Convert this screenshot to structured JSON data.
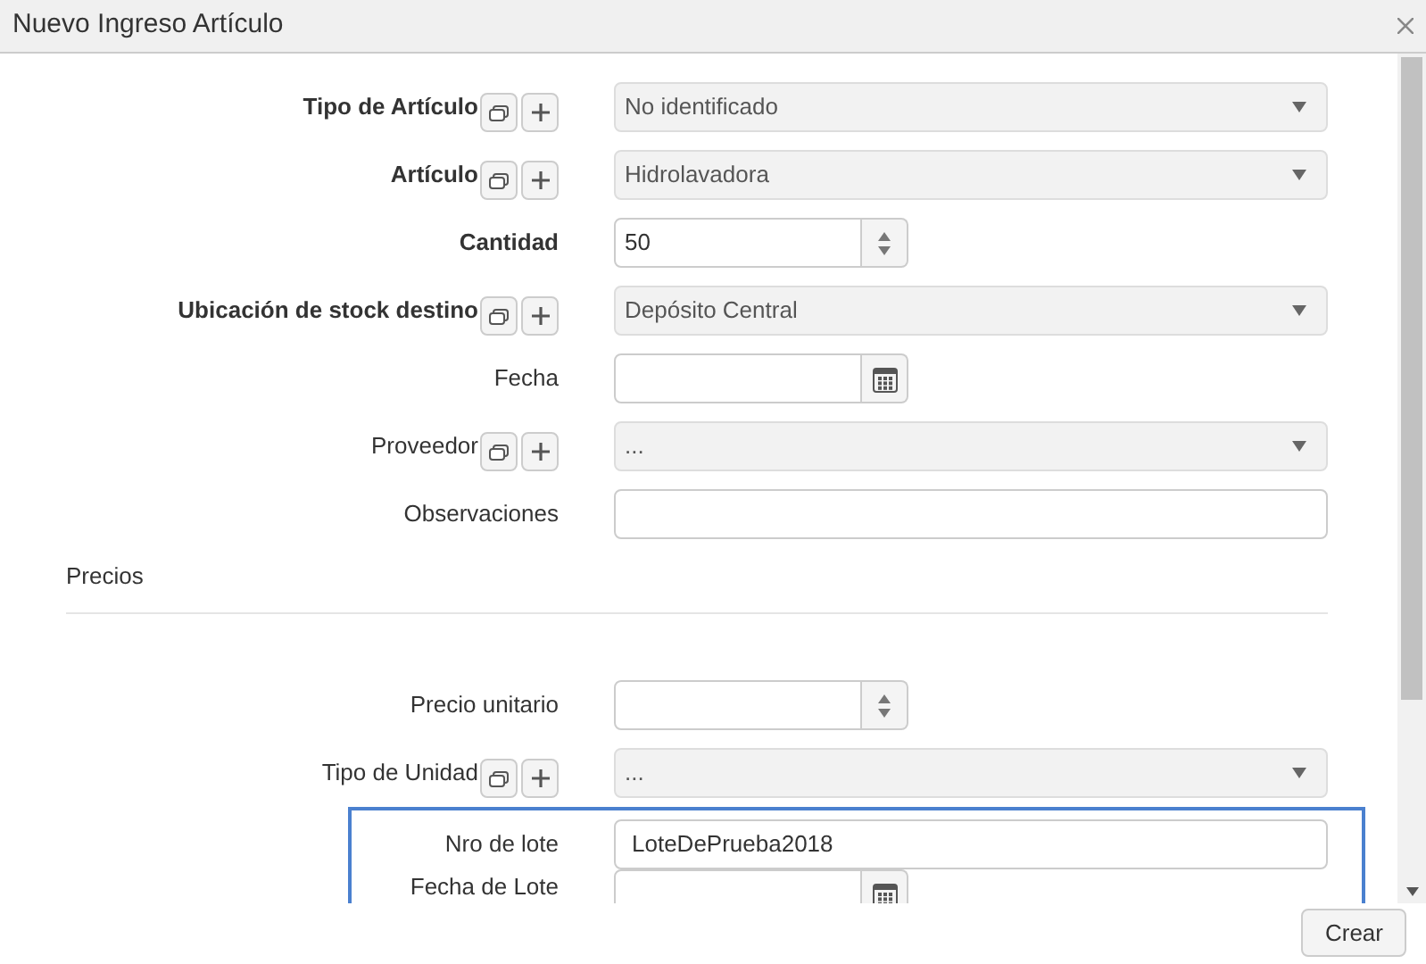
{
  "window": {
    "title": "Nuevo Ingreso Artículo"
  },
  "fields": [
    {
      "label": "Tipo de Artículo",
      "bold": true,
      "kind": "select",
      "lookup_buttons": true,
      "value": "No identificado"
    },
    {
      "label": "Artículo",
      "bold": true,
      "kind": "select",
      "lookup_buttons": true,
      "value": "Hidrolavadora"
    },
    {
      "label": "Cantidad",
      "bold": true,
      "kind": "number",
      "lookup_buttons": false,
      "value": "50"
    },
    {
      "label": "Ubicación de stock destino",
      "bold": true,
      "kind": "select",
      "lookup_buttons": true,
      "value": "Depósito Central"
    },
    {
      "label": "Fecha",
      "bold": false,
      "kind": "date",
      "lookup_buttons": false
    },
    {
      "label": "Proveedor",
      "bold": false,
      "kind": "select",
      "lookup_buttons": true,
      "value": "..."
    },
    {
      "label": "Observaciones",
      "bold": false,
      "kind": "text",
      "lookup_buttons": false
    }
  ],
  "section": {
    "title": "Precios"
  },
  "price_fields": [
    {
      "label": "Precio unitario",
      "bold": false,
      "kind": "number",
      "lookup_buttons": false
    },
    {
      "label": "Tipo de Unidad",
      "bold": false,
      "kind": "select",
      "lookup_buttons": true,
      "value": "..."
    }
  ],
  "highlighted_fields": [
    {
      "label": "Nro de lote",
      "bold": false,
      "kind": "text",
      "lookup_buttons": false,
      "value": "LoteDePrueba2018"
    },
    {
      "label": "Fecha de Lote",
      "bold": false,
      "kind": "date",
      "lookup_buttons": false
    }
  ],
  "buttons": [
    {
      "label": "Crear"
    }
  ]
}
